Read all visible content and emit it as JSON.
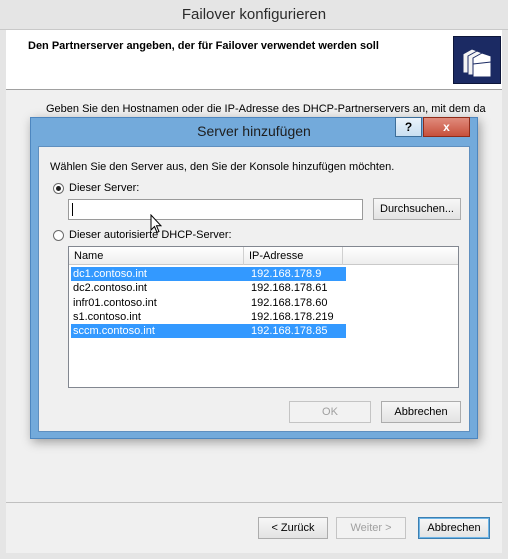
{
  "outer": {
    "title": "Failover konfigurieren",
    "header_title": "Den Partnerserver angeben, der für Failover verwendet werden soll",
    "description": "Geben Sie den Hostnamen oder die IP-Adresse des DHCP-Partnerservers an, mit dem das",
    "back_label": "< Zurück",
    "next_label": "Weiter >",
    "cancel_label": "Abbrechen"
  },
  "dialog": {
    "title": "Server hinzufügen",
    "help_label": "?",
    "close_label": "x",
    "instruction": "Wählen Sie den Server aus, den Sie der Konsole hinzufügen möchten.",
    "this_server_label": "Dieser Server:",
    "this_server_value": "",
    "browse_label": "Durchsuchen...",
    "authorized_label": "Dieser autorisierte DHCP-Server:",
    "columns": [
      "Name",
      "IP-Adresse"
    ],
    "servers": [
      {
        "name": "dc1.contoso.int",
        "ip": "192.168.178.9",
        "selected": true
      },
      {
        "name": "dc2.contoso.int",
        "ip": "192.168.178.61",
        "selected": false
      },
      {
        "name": "infr01.contoso.int",
        "ip": "192.168.178.60",
        "selected": false
      },
      {
        "name": "s1.contoso.int",
        "ip": "192.168.178.219",
        "selected": false
      },
      {
        "name": "sccm.contoso.int",
        "ip": "192.168.178.85",
        "selected": true
      }
    ],
    "ok_label": "OK",
    "cancel_label": "Abbrechen"
  },
  "colors": {
    "dialog_frame": "#73aadb",
    "selection": "#3399ff",
    "close_button": "#c7503c"
  }
}
